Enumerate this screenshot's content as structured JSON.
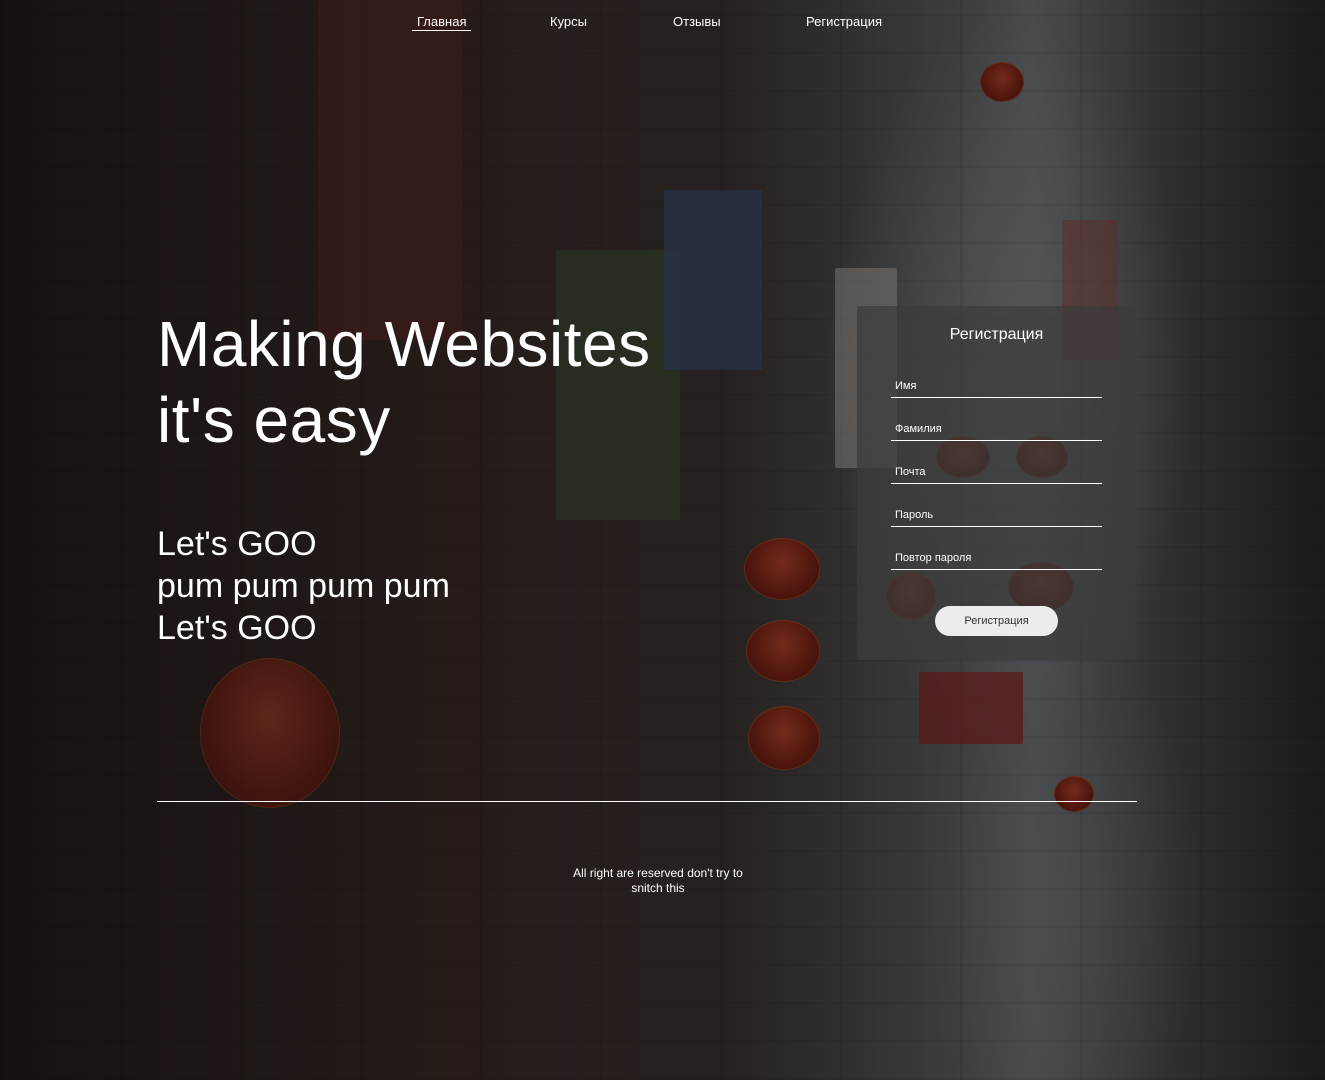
{
  "nav": {
    "items": [
      {
        "label": "Главная",
        "active": true
      },
      {
        "label": "Курсы",
        "active": false
      },
      {
        "label": "Отзывы",
        "active": false
      },
      {
        "label": "Регистрация",
        "active": false
      }
    ]
  },
  "hero": {
    "title_line1": "Making Websites",
    "title_line2": "it's easy",
    "sub_line1": "Let's GOO",
    "sub_line2": "pum pum pum pum",
    "sub_line3": "Let's GOO"
  },
  "form": {
    "title": "Регистрация",
    "fields": [
      {
        "placeholder": "Имя",
        "value": ""
      },
      {
        "placeholder": "Фамилия",
        "value": ""
      },
      {
        "placeholder": "Почта",
        "value": ""
      },
      {
        "placeholder": "Пароль",
        "value": ""
      },
      {
        "placeholder": "Повтор пароля",
        "value": ""
      }
    ],
    "submit_label": "Регистрация"
  },
  "footer": {
    "text_line1": "All right are reserved don't try to",
    "text_line2": "snitch this"
  },
  "colors": {
    "text": "#ffffff",
    "panel": "#3c3c3c",
    "button_bg": "#ececec",
    "button_text": "#333333"
  }
}
